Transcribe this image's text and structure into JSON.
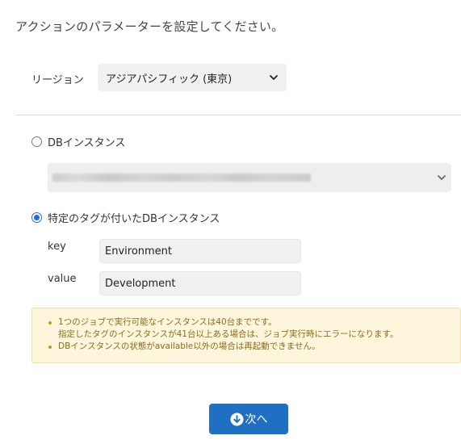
{
  "page": {
    "title": "アクションのパラメーターを設定してください。"
  },
  "region": {
    "label": "リージョン",
    "selected": "アジアパシフィック (東京)"
  },
  "target": {
    "option_db_instance_label": "DBインスタンス",
    "option_tagged_label": "特定のタグが付いたDBインスタンス",
    "selected_option": "特定のタグが付いたDBインスタンス"
  },
  "tag": {
    "key_label": "key",
    "key_value": "Environment",
    "value_label": "value",
    "value_value": "Development"
  },
  "notice": {
    "item1_line1": "1つのジョブで実行可能なインスタンスは40台までです。",
    "item1_line2": "指定したタグのインスタンスが41台以上ある場合は、ジョブ実行時にエラーになります。",
    "item2": "DBインスタンスの状態がavailable以外の場合は再起動できません。"
  },
  "actions": {
    "next_label": "次へ"
  },
  "colors": {
    "primary": "#1f6fc2",
    "radio_selected": "#1f6fd6",
    "notice_bg": "#fdf6dc",
    "notice_text": "#8a6d1a"
  },
  "icons": {
    "next": "arrow-down-circle-icon",
    "dropdown": "chevron-down-icon"
  }
}
